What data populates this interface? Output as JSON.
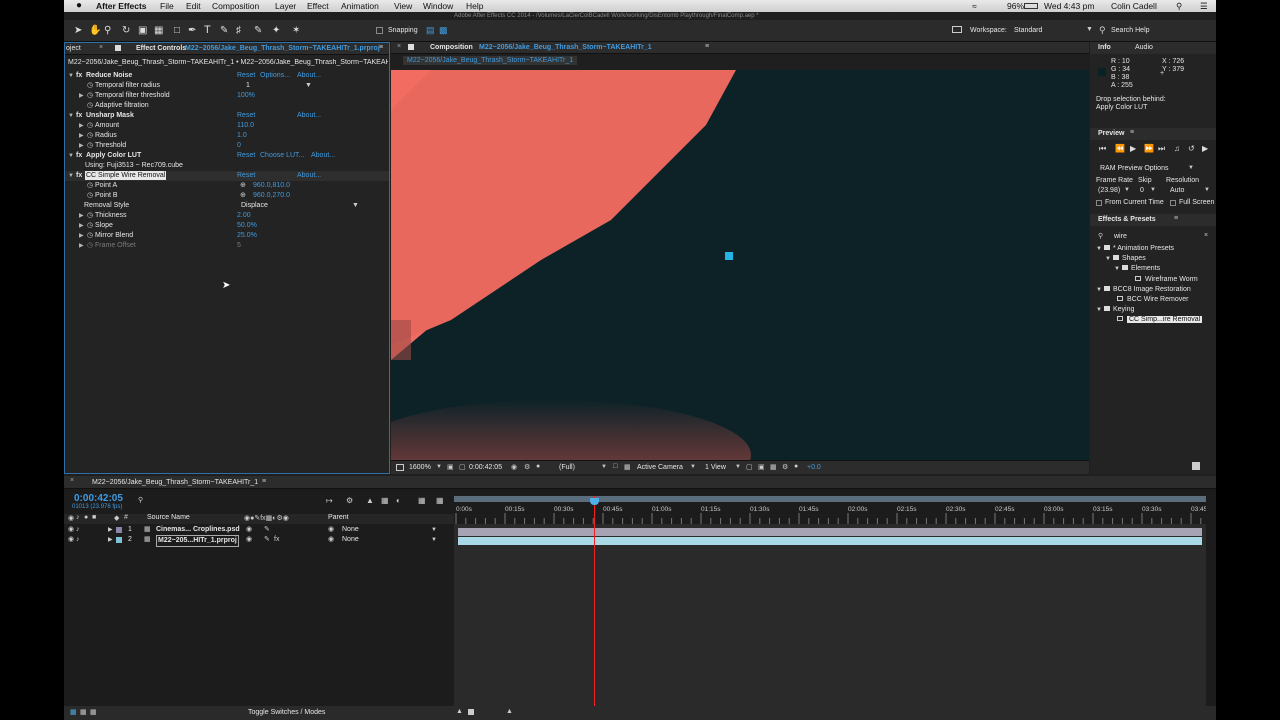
{
  "menubar": {
    "apple": "",
    "app": "After Effects",
    "items": [
      "File",
      "Edit",
      "Composition",
      "Layer",
      "Effect",
      "Animation",
      "View",
      "Window",
      "Help"
    ],
    "title": "Adobe After Effects CC 2014 - /Volumes/LaCie/ColBCadell Work/working/DisEntomb Playthrough/FinalComp.aep *",
    "battery": "96%",
    "clock": "Wed 4:43 pm",
    "user": "Colin Cadell"
  },
  "toolbar": {
    "snapping": "Snapping",
    "workspace_label": "Workspace:",
    "workspace_value": "Standard",
    "search": "Search Help"
  },
  "project_tab": {
    "label": "oject"
  },
  "effect_controls": {
    "tab": "Effect Controls",
    "tab_target": "M22~2056/Jake_Beug_Thrash_Storm~TAKEAHITr_1.prproj",
    "breadcrumb": "M22~2056/Jake_Beug_Thrash_Storm~TAKEAHITr_1 • M22~2056/Jake_Beug_Thrash_Storm~TAKEAHI",
    "reset": "Reset",
    "options": "Options...",
    "about": "About...",
    "choose_lut": "Choose LUT...",
    "reduce_noise": {
      "name": "Reduce Noise",
      "p1": "Temporal filter radius",
      "v1": "1",
      "p2": "Temporal filter threshold",
      "v2": "100%",
      "p3": "Adaptive filtration"
    },
    "unsharp": {
      "name": "Unsharp Mask",
      "p1": "Amount",
      "v1": "110.0",
      "p2": "Radius",
      "v2": "1.0",
      "p3": "Threshold",
      "v3": "0"
    },
    "lut": {
      "name": "Apply Color LUT",
      "using": "Using: Fuji3513 ~ Rec709.cube"
    },
    "wire": {
      "name": "CC Simple Wire Removal",
      "p1": "Point A",
      "v1": "960.0,810.0",
      "p2": "Point B",
      "v2": "960.0,270.0",
      "p3": "Removal Style",
      "v3": "Displace",
      "p4": "Thickness",
      "v4": "2.00",
      "p5": "Slope",
      "v5": "50.0%",
      "p6": "Mirror Blend",
      "v6": "25.0%",
      "p7": "Frame Offset",
      "v7": "5"
    }
  },
  "composition": {
    "tab_prefix": "Composition",
    "tab": "M22~2056/Jake_Beug_Thrash_Storm~TAKEAHITr_1",
    "subtab": "M22~2056/Jake_Beug_Thrash_Storm~TAKEAHITr_1",
    "zoom": "1600%",
    "timecode": "0:00:42:05",
    "resolution": "(Full)",
    "camera": "Active Camera",
    "views": "1 View",
    "exposure": "+0.0"
  },
  "info": {
    "tab": "Info",
    "tab2": "Audio",
    "r": "R : 10",
    "g": "G : 34",
    "b": "B : 38",
    "a": "A : 255",
    "x": "X : 726",
    "y": "Y : 379",
    "drop": "Drop selection behind:",
    "drop2": "Apply Color LUT"
  },
  "preview": {
    "tab": "Preview",
    "ram": "RAM Preview Options",
    "frame_rate": "Frame Rate",
    "skip": "Skip",
    "resolution": "Resolution",
    "fr_val": "(23.98)",
    "skip_val": "0",
    "res_val": "Auto",
    "from_current": "From Current Time",
    "full_screen": "Full Screen"
  },
  "effects": {
    "tab": "Effects & Presets",
    "search": "wire",
    "tree": [
      {
        "label": "* Animation Presets",
        "level": 0,
        "kind": "folder"
      },
      {
        "label": "Shapes",
        "level": 1,
        "kind": "folder"
      },
      {
        "label": "Elements",
        "level": 2,
        "kind": "folder"
      },
      {
        "label": "Wireframe Worm",
        "level": 3,
        "kind": "item"
      },
      {
        "label": "BCC8 Image Restoration",
        "level": 0,
        "kind": "folder"
      },
      {
        "label": "BCC Wire Remover",
        "level": 1,
        "kind": "item"
      },
      {
        "label": "Keying",
        "level": 0,
        "kind": "folder"
      },
      {
        "label": "CC Simp...ire Removal",
        "level": 1,
        "kind": "selected"
      }
    ]
  },
  "timeline": {
    "tab": "M22~2056/Jake_Beug_Thrash_Storm~TAKEAHITr_1",
    "timecode": "0:00:42:05",
    "frames": "01013 (23.976 fps)",
    "source_name": "Source Name",
    "parent": "Parent",
    "toggle": "Toggle Switches / Modes",
    "layers": [
      {
        "num": "1",
        "name": "Cinemas... Croplines.psd",
        "parent": "None"
      },
      {
        "num": "2",
        "name": "M22~205...HITr_1.prproj",
        "parent": "None"
      }
    ],
    "ruler": [
      "0:00s",
      "00:15s",
      "00:30s",
      "00:45s",
      "01:00s",
      "01:15s",
      "01:30s",
      "01:45s",
      "02:00s",
      "02:15s",
      "02:30s",
      "02:45s",
      "03:00s",
      "03:15s",
      "03:30s",
      "03:45s"
    ]
  }
}
